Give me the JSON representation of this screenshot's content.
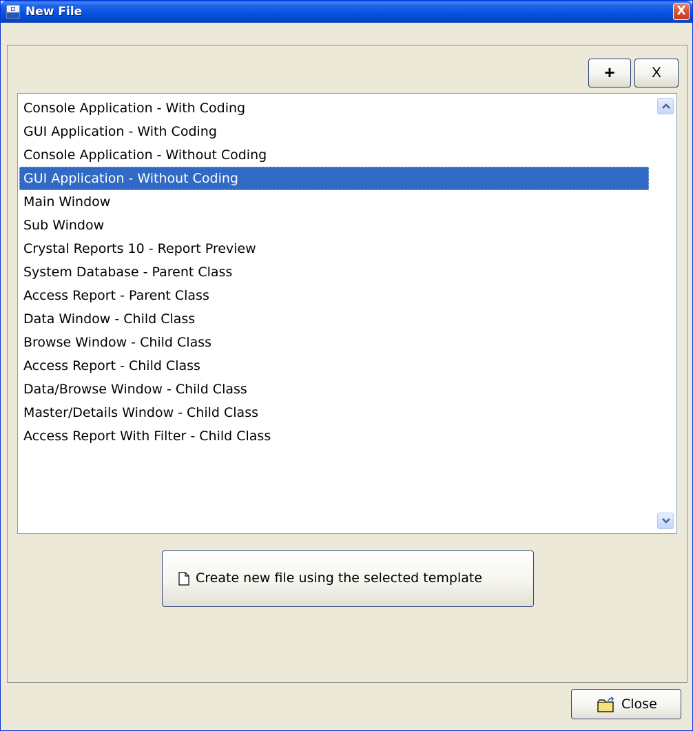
{
  "window": {
    "title": "New File",
    "close_glyph": "X"
  },
  "toolbar": {
    "add_label": "+",
    "remove_label": "X"
  },
  "templates": {
    "selected_index": 3,
    "items": [
      "Console Application - With Coding",
      "GUI Application - With Coding",
      "Console Application - Without Coding",
      "GUI Application - Without Coding",
      "Main Window",
      "Sub Window",
      "Crystal Reports 10 - Report Preview",
      "System Database - Parent Class",
      "Access Report - Parent Class",
      "Data Window - Child Class",
      "Browse Window - Child Class",
      "Access Report - Child Class",
      "Data/Browse Window - Child Class",
      "Master/Details Window - Child Class",
      "Access Report With Filter - Child Class"
    ]
  },
  "actions": {
    "create_label": "Create new file using the selected template",
    "close_label": "Close"
  },
  "icons": {
    "app": "app-icon",
    "add": "plus-icon",
    "remove": "x-icon",
    "create": "document-icon",
    "close": "folder-icon",
    "scroll_up": "chevron-up-icon",
    "scroll_down": "chevron-down-icon"
  },
  "colors": {
    "titlebar": "#0654e0",
    "selection": "#316ac5",
    "window_bg": "#ece9d8",
    "close_button": "#d8553a"
  }
}
